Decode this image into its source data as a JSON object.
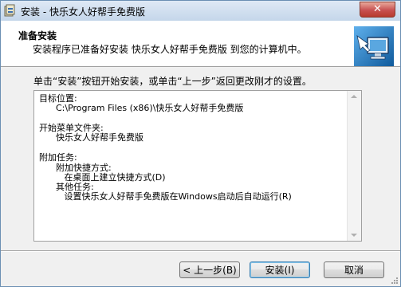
{
  "window": {
    "title": "安装 - 快乐女人好帮手免费版",
    "close_symbol": "✕"
  },
  "header": {
    "title": "准备安装",
    "subtitle": "安装程序已准备好安装 快乐女人好帮手免费版 到您的计算机中。"
  },
  "instruction": "单击“安装”按钮开始安装，或单击“上一步”返回更改刚才的设置。",
  "summary": {
    "lines": [
      "目标位置:",
      "      C:\\Program Files (x86)\\快乐女人好帮手免费版",
      "开始菜单文件夹:",
      "      快乐女人好帮手免费版",
      "附加任务:",
      "      附加快捷方式:",
      "         在桌面上建立快捷方式(D)",
      "      其他任务:",
      "         设置快乐女人好帮手免费版在Windows启动后自动运行(R)"
    ]
  },
  "buttons": {
    "back": "< 上一步(B)",
    "install": "安装(I)",
    "cancel": "取消"
  },
  "icons": {
    "app": "installer-icon",
    "header": "computer-install-icon",
    "close": "close-icon"
  }
}
